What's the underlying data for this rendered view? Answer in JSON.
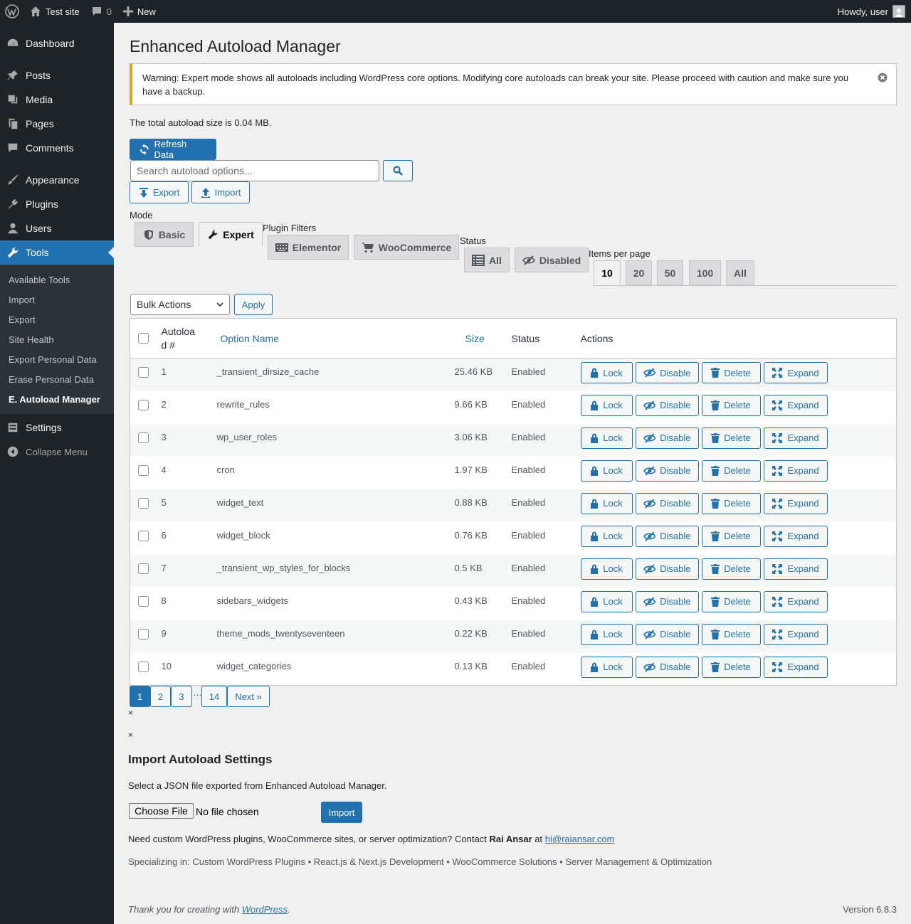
{
  "admin_bar": {
    "site_name": "Test site",
    "comments_count": "0",
    "new_label": "New",
    "howdy": "Howdy, user"
  },
  "sidebar": {
    "items": [
      {
        "label": "Dashboard",
        "icon": "dashboard-icon"
      },
      {
        "label": "Posts",
        "icon": "pin-icon"
      },
      {
        "label": "Media",
        "icon": "media-icon"
      },
      {
        "label": "Pages",
        "icon": "pages-icon"
      },
      {
        "label": "Comments",
        "icon": "comment-icon"
      },
      {
        "label": "Appearance",
        "icon": "brush-icon"
      },
      {
        "label": "Plugins",
        "icon": "plugin-icon"
      },
      {
        "label": "Users",
        "icon": "users-icon"
      },
      {
        "label": "Tools",
        "icon": "wrench-icon"
      },
      {
        "label": "Settings",
        "icon": "settings-icon"
      }
    ],
    "submenu": [
      "Available Tools",
      "Import",
      "Export",
      "Site Health",
      "Export Personal Data",
      "Erase Personal Data",
      "E. Autoload Manager"
    ],
    "collapse": "Collapse Menu"
  },
  "page": {
    "title": "Enhanced Autoload Manager",
    "warning": "Warning: Expert mode shows all autoloads including WordPress core options. Modifying core autoloads can break your site. Please proceed with caution and make sure you have a backup.",
    "total": "The total autoload size is 0.04 MB.",
    "refresh": "Refresh Data",
    "search_placeholder": "Search autoload options...",
    "export": "Export",
    "import": "Import"
  },
  "filters": {
    "mode_label": "Mode",
    "mode_tabs": [
      "Basic",
      "Expert"
    ],
    "plugin_label": "Plugin Filters",
    "plugin_tabs": [
      "Elementor",
      "WooCommerce"
    ],
    "status_label": "Status",
    "status_tabs": [
      "All",
      "Disabled"
    ],
    "items_label": "Items per page",
    "items_tabs": [
      "10",
      "20",
      "50",
      "100",
      "All"
    ]
  },
  "bulk": {
    "label": "Bulk Actions",
    "apply": "Apply"
  },
  "table": {
    "headers": {
      "autoload": "Autoloa d #",
      "name": "Option Name",
      "size": "Size",
      "status": "Status",
      "actions": "Actions"
    },
    "action_labels": {
      "lock": "Lock",
      "disable": "Disable",
      "delete": "Delete",
      "expand": "Expand"
    },
    "rows": [
      {
        "num": "1",
        "name": "_transient_dirsize_cache",
        "size": "25.46 KB",
        "status": "Enabled"
      },
      {
        "num": "2",
        "name": "rewrite_rules",
        "size": "9.66 KB",
        "status": "Enabled"
      },
      {
        "num": "3",
        "name": "wp_user_roles",
        "size": "3.06 KB",
        "status": "Enabled"
      },
      {
        "num": "4",
        "name": "cron",
        "size": "1.97 KB",
        "status": "Enabled"
      },
      {
        "num": "5",
        "name": "widget_text",
        "size": "0.88 KB",
        "status": "Enabled"
      },
      {
        "num": "6",
        "name": "widget_block",
        "size": "0.76 KB",
        "status": "Enabled"
      },
      {
        "num": "7",
        "name": "_transient_wp_styles_for_blocks",
        "size": "0.5 KB",
        "status": "Enabled"
      },
      {
        "num": "8",
        "name": "sidebars_widgets",
        "size": "0.43 KB",
        "status": "Enabled"
      },
      {
        "num": "9",
        "name": "theme_mods_twentyseventeen",
        "size": "0.22 KB",
        "status": "Enabled"
      },
      {
        "num": "10",
        "name": "widget_categories",
        "size": "0.13 KB",
        "status": "Enabled"
      }
    ]
  },
  "pagination": {
    "pages": [
      "1",
      "2",
      "3"
    ],
    "dots": "…",
    "last": "14",
    "next": "Next »"
  },
  "close_marks": [
    "×",
    "×"
  ],
  "import_section": {
    "title": "Import Autoload Settings",
    "desc": "Select a JSON file exported from Enhanced Autoload Manager.",
    "choose": "Choose File",
    "no_file": "No file chosen",
    "button": "Import"
  },
  "credit": {
    "pre": "Need custom WordPress plugins, WooCommerce sites, or server optimization? Contact ",
    "name": "Rai Ansar",
    "at": " at ",
    "email": "hi@raiansar.com"
  },
  "specializing": "Specializing in: Custom WordPress Plugins • React.js & Next.js Development • WooCommerce Solutions • Server Management & Optimization",
  "footer": {
    "pre": "Thank you for creating with ",
    "link": "WordPress",
    "post": ".",
    "version": "Version 6.8.3"
  }
}
